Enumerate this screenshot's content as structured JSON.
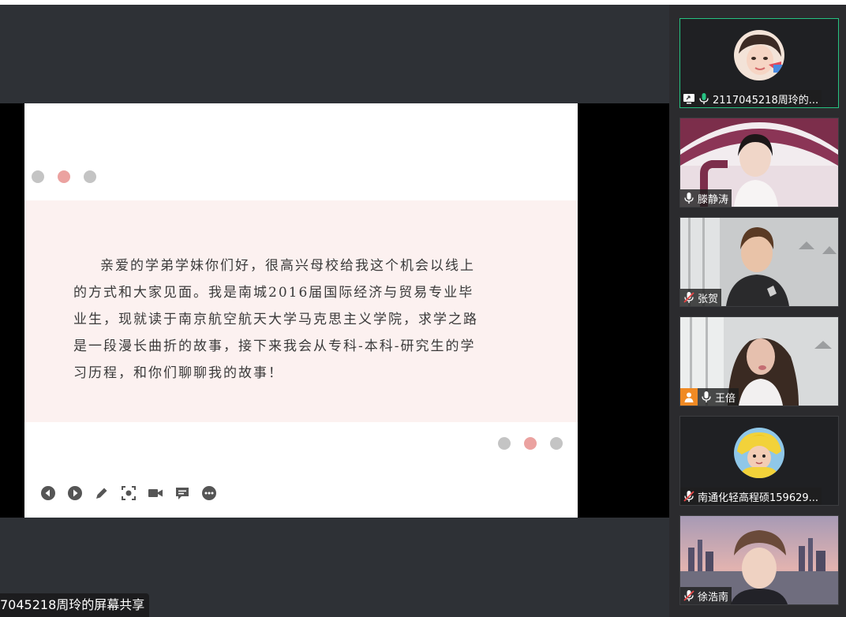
{
  "slide": {
    "paragraph": "亲爱的学弟学妹你们好，很高兴母校给我这个机会以线上的方式和大家见面。我是南城2016届国际经济与贸易专业毕业生，现就读于南京航空航天大学马克思主义学院，求学之路是一段漫长曲折的故事，接下来我会从专科-本科-研究生的学习历程，和你们聊聊我的故事！"
  },
  "share_label": "7045218周玲的屏幕共享",
  "participants": [
    {
      "name": "2117045218周玲的...",
      "mic": "on",
      "sharing": true,
      "video": false
    },
    {
      "name": "滕静涛",
      "mic": "on",
      "video": true
    },
    {
      "name": "张贺",
      "mic": "muted",
      "video": true
    },
    {
      "name": "王倍",
      "mic": "on",
      "host": true,
      "video": true
    },
    {
      "name": "南通化轻高程硕159629...",
      "mic": "muted",
      "video": false
    },
    {
      "name": "徐浩南",
      "mic": "muted",
      "video": true
    }
  ],
  "colors": {
    "accent_active": "#26c281",
    "host_badge": "#f08a24",
    "slide_pink": "#fcf1f0",
    "dot_pink": "#eba2a0"
  },
  "icons": {
    "controls": [
      "prev-icon",
      "next-icon",
      "pen-icon",
      "focus-icon",
      "camera-icon",
      "comment-icon",
      "more-icon"
    ]
  }
}
